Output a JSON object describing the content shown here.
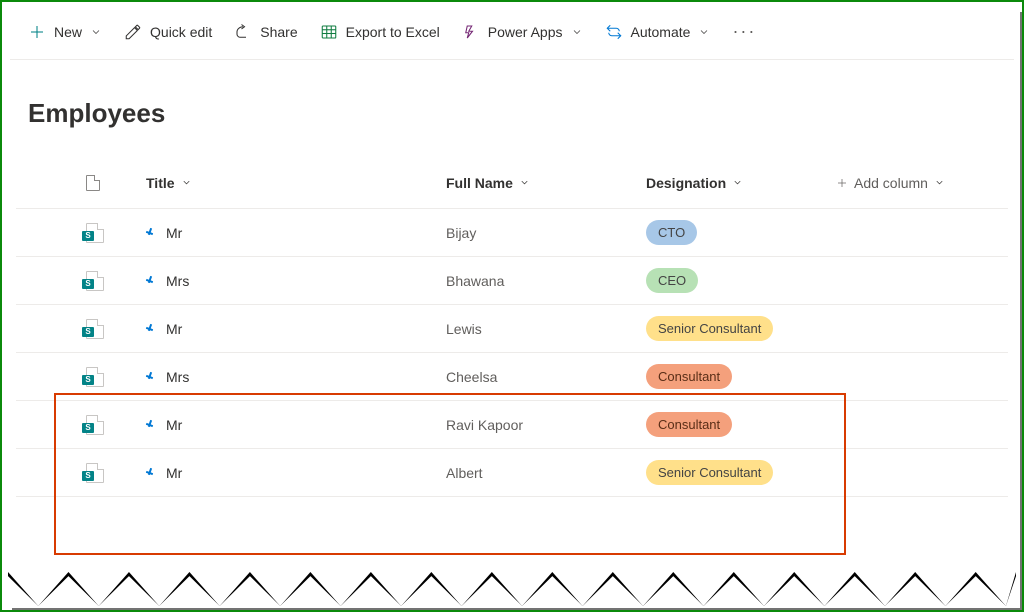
{
  "commands": {
    "new": "New",
    "quick_edit": "Quick edit",
    "share": "Share",
    "export_excel": "Export to Excel",
    "power_apps": "Power Apps",
    "automate": "Automate"
  },
  "page": {
    "title": "Employees"
  },
  "columns": {
    "title": "Title",
    "full_name": "Full Name",
    "designation": "Designation",
    "add_column": "Add column"
  },
  "designation_styles": {
    "CTO": "blue",
    "CEO": "green",
    "Senior Consultant": "yellow",
    "Consultant": "orange"
  },
  "rows": [
    {
      "title": "Mr",
      "full_name": "Bijay",
      "designation": "CTO"
    },
    {
      "title": "Mrs",
      "full_name": "Bhawana",
      "designation": "CEO"
    },
    {
      "title": "Mr",
      "full_name": "Lewis",
      "designation": "Senior Consultant"
    },
    {
      "title": "Mrs",
      "full_name": "Cheelsa",
      "designation": "Consultant"
    },
    {
      "title": "Mr",
      "full_name": "Ravi Kapoor",
      "designation": "Consultant"
    },
    {
      "title": "Mr",
      "full_name": "Albert",
      "designation": "Senior Consultant"
    }
  ]
}
